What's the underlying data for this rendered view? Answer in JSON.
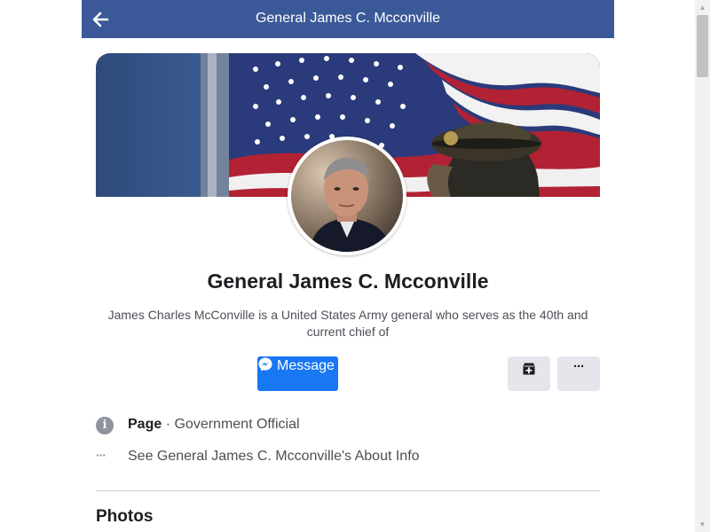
{
  "header": {
    "title": "General James C. Mcconville",
    "back_icon": "arrow-left-icon",
    "background": "#3b5998"
  },
  "profile": {
    "name": "General James C. Mcconville",
    "description": "James Charles McConville is a United States Army general who serves as the 40th and current chief of"
  },
  "actions": {
    "message_label": "Message",
    "message_icon": "messenger-icon",
    "save_icon": "bookmark-add-icon",
    "more_label": "···",
    "accent": "#1877f2"
  },
  "info": {
    "category_prefix": "Page",
    "category_separator": " · ",
    "category_value": "Government Official",
    "about_dots": "···",
    "about_link": "See General James C. Mcconville's About Info"
  },
  "sections": {
    "photos_heading": "Photos"
  }
}
